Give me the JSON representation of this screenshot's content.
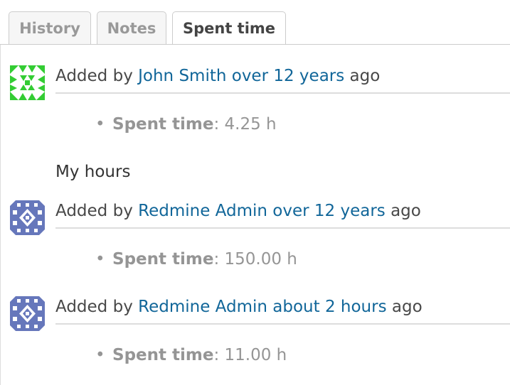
{
  "tabs": [
    {
      "label": "History",
      "selected": false
    },
    {
      "label": "Notes",
      "selected": false
    },
    {
      "label": "Spent time",
      "selected": true
    }
  ],
  "journals": [
    {
      "prefix": "Added by",
      "author": "John Smith",
      "age": "over 12 years",
      "suffix": "ago",
      "avatar_colors": [
        "#33cc33",
        "#ffffff"
      ],
      "detail_label": "Spent time",
      "detail_sep": ":",
      "detail_value": "4.25 h",
      "note": "My hours"
    },
    {
      "prefix": "Added by",
      "author": "Redmine Admin",
      "age": "over 12 years",
      "suffix": "ago",
      "avatar_colors": [
        "#6677bb",
        "#ffffff"
      ],
      "detail_label": "Spent time",
      "detail_sep": ":",
      "detail_value": "150.00 h"
    },
    {
      "prefix": "Added by",
      "author": "Redmine Admin",
      "age": "about 2 hours",
      "suffix": "ago",
      "avatar_colors": [
        "#6677bb",
        "#ffffff"
      ],
      "detail_label": "Spent time",
      "detail_sep": ":",
      "detail_value": "11.00 h"
    }
  ],
  "colors": {
    "link": "#116699",
    "muted": "#959595"
  }
}
